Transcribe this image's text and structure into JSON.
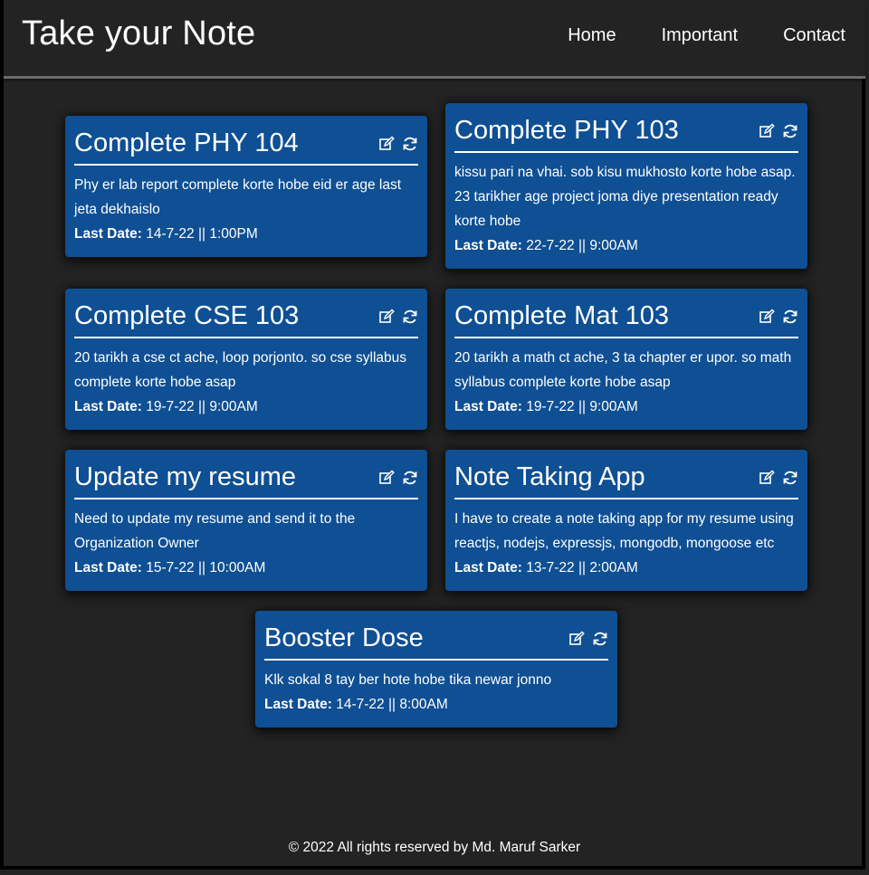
{
  "header": {
    "brand": "Take your Note",
    "nav": [
      {
        "label": "Home"
      },
      {
        "label": "Important"
      },
      {
        "label": "Contact"
      }
    ]
  },
  "notes": [
    {
      "title": "Complete PHY 104",
      "description": "Phy er lab report complete korte hobe eid er age last jeta dekhaislo",
      "date_label": "Last Date:",
      "date_value": "14-7-22 || 1:00PM"
    },
    {
      "title": "Complete PHY 103",
      "description": "kissu pari na vhai. sob kisu mukhosto korte hobe asap. 23 tarikher age project joma diye presentation ready korte hobe",
      "date_label": "Last Date:",
      "date_value": "22-7-22 || 9:00AM"
    },
    {
      "title": "Complete CSE 103",
      "description": "20 tarikh a cse ct ache, loop porjonto. so cse syllabus complete korte hobe asap",
      "date_label": "Last Date:",
      "date_value": "19-7-22 || 9:00AM"
    },
    {
      "title": "Complete Mat 103",
      "description": "20 tarikh a math ct ache, 3 ta chapter er upor. so math syllabus complete korte hobe asap",
      "date_label": "Last Date:",
      "date_value": "19-7-22 || 9:00AM"
    },
    {
      "title": "Update my resume",
      "description": "Need to update my resume and send it to the Organization Owner",
      "date_label": "Last Date:",
      "date_value": "15-7-22 || 10:00AM"
    },
    {
      "title": "Note Taking App",
      "description": "I have to create a note taking app for my resume using reactjs, nodejs, expressjs, mongodb, mongoose etc",
      "date_label": "Last Date:",
      "date_value": "13-7-22 || 2:00AM"
    },
    {
      "title": "Booster Dose",
      "description": "Klk sokal 8 tay ber hote hobe tika newar jonno",
      "date_label": "Last Date:",
      "date_value": "14-7-22 || 8:00AM"
    }
  ],
  "icons": {
    "edit": "edit-icon",
    "refresh": "refresh-icon"
  },
  "colors": {
    "background": "#232323",
    "card": "#0f4f93",
    "text": "#ffffff"
  },
  "footer": {
    "text": "© 2022 All rights reserved by Md. Maruf Sarker"
  }
}
